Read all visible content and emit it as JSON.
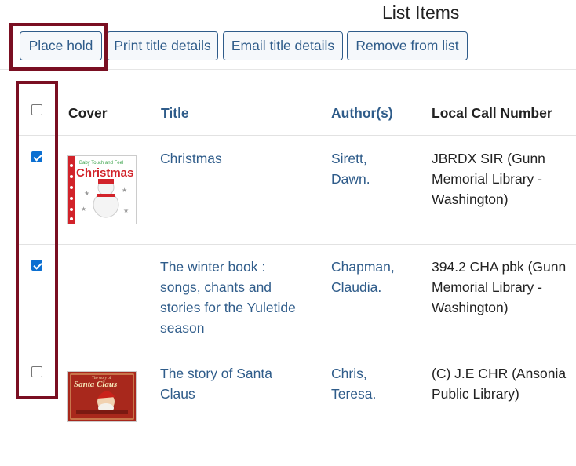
{
  "page": {
    "title": "List Items"
  },
  "toolbar": {
    "place_hold": "Place hold",
    "print": "Print title details",
    "email": "Email title details",
    "remove": "Remove from list"
  },
  "table": {
    "columns": [
      "Cover",
      "Title",
      "Author(s)",
      "Local Call Number"
    ],
    "select_all_checked": false,
    "rows": [
      {
        "checked": true,
        "cover_icon": "christmas-book-cover",
        "cover_text": [
          "Baby Touch and Feel",
          "Christmas"
        ],
        "title_lines": [
          "Christmas"
        ],
        "author_lines": [
          "Sirett,",
          "Dawn."
        ],
        "call_lines": [
          "JBRDX SIR (Gunn",
          "Memorial Library -",
          "Washington)"
        ]
      },
      {
        "checked": true,
        "cover_icon": "",
        "title_lines": [
          "The winter book :",
          "songs, chants and",
          "stories for the Yuletide",
          "season"
        ],
        "author_lines": [
          "Chapman,",
          "Claudia."
        ],
        "call_lines": [
          "394.2 CHA pbk (Gunn",
          "Memorial Library -",
          "Washington)"
        ]
      },
      {
        "checked": false,
        "cover_icon": "santa-claus-book-cover",
        "cover_text": [
          "The story of",
          "Santa Claus"
        ],
        "title_lines": [
          "The story of Santa",
          "Claus"
        ],
        "author_lines": [
          "Chris,",
          "Teresa."
        ],
        "call_lines": [
          "(C) J.E CHR (Ansonia",
          "Public Library)"
        ]
      }
    ]
  },
  "colors": {
    "link": "#2f5c8a",
    "highlight": "#7a0f22",
    "checkbox": "#0b6fd1"
  }
}
